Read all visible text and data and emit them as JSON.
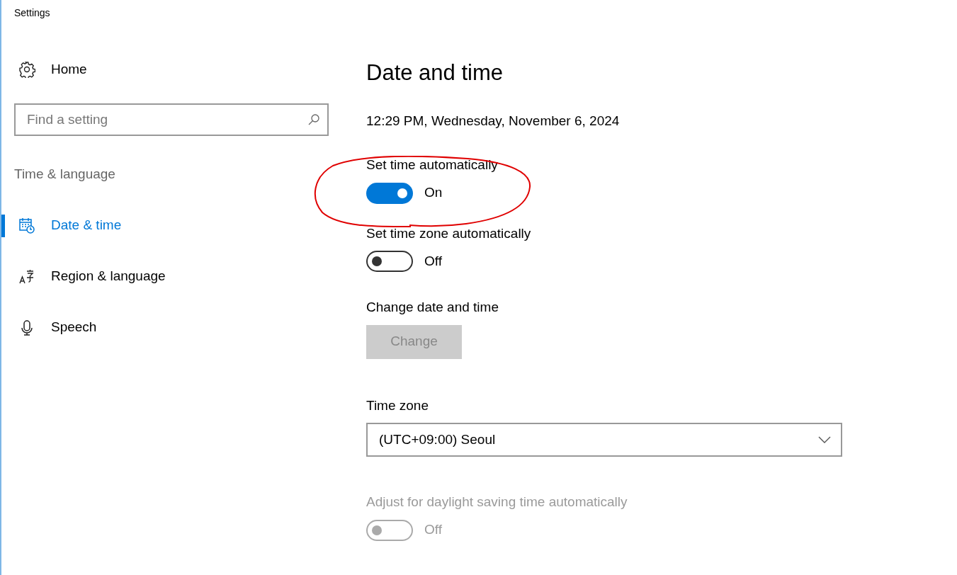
{
  "window": {
    "title": "Settings"
  },
  "sidebar": {
    "home": "Home",
    "search": {
      "placeholder": "Find a setting"
    },
    "section": "Time & language",
    "items": [
      {
        "label": "Date & time",
        "selected": true
      },
      {
        "label": "Region & language",
        "selected": false
      },
      {
        "label": "Speech",
        "selected": false
      }
    ]
  },
  "content": {
    "title": "Date and time",
    "current_time": "12:29 PM, Wednesday, November 6, 2024",
    "settings": [
      {
        "kind": "toggle",
        "label": "Set time automatically",
        "on": true,
        "state_text": "On",
        "disabled": false
      },
      {
        "kind": "toggle",
        "label": "Set time zone automatically",
        "on": false,
        "state_text": "Off",
        "disabled": false
      },
      {
        "kind": "button",
        "label": "Change date and time",
        "button_label": "Change",
        "disabled": true
      },
      {
        "kind": "select",
        "label": "Time zone",
        "value": "(UTC+09:00) Seoul"
      },
      {
        "kind": "toggle",
        "label": "Adjust for daylight saving time automatically",
        "on": false,
        "state_text": "Off",
        "disabled": true
      }
    ]
  }
}
